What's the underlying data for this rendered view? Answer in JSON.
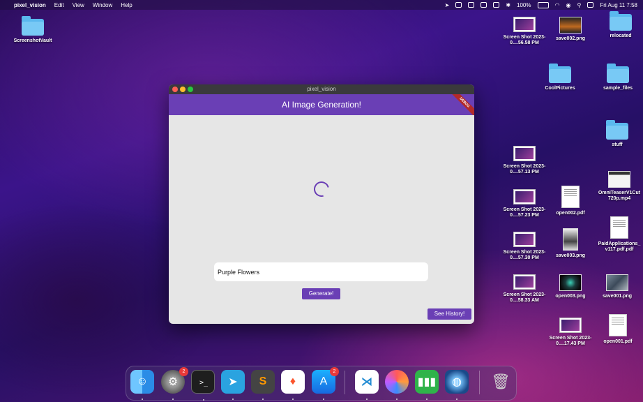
{
  "menubar": {
    "app_name": "pixel_vision",
    "items": [
      "Edit",
      "View",
      "Window",
      "Help"
    ],
    "battery": "100%",
    "clock": "Fri Aug 11  7:58"
  },
  "desktop": {
    "items": [
      {
        "name": "ScreenshotVault",
        "kind": "folder"
      },
      {
        "name": "Screen Shot 2023-0....56.58 PM",
        "kind": "screenshot"
      },
      {
        "name": "save002.png",
        "kind": "image"
      },
      {
        "name": "relocated",
        "kind": "folder"
      },
      {
        "name": "CoolPictures",
        "kind": "folder"
      },
      {
        "name": "sample_files",
        "kind": "folder"
      },
      {
        "name": "stuff",
        "kind": "folder"
      },
      {
        "name": "Screen Shot 2023-0....57.13 PM",
        "kind": "screenshot"
      },
      {
        "name": "OmniTeaserV1Cut 720p.mp4",
        "kind": "video"
      },
      {
        "name": "Screen Shot 2023-0....57.23 PM",
        "kind": "screenshot"
      },
      {
        "name": "open002.pdf",
        "kind": "pdf"
      },
      {
        "name": "PaidApplications_ v117.pdf.pdf",
        "kind": "pdf"
      },
      {
        "name": "Screen Shot 2023-0....57.30 PM",
        "kind": "screenshot"
      },
      {
        "name": "save003.png",
        "kind": "image"
      },
      {
        "name": "Screen Shot 2023-0....58.33 AM",
        "kind": "screenshot"
      },
      {
        "name": "open003.png",
        "kind": "image"
      },
      {
        "name": "save001.png",
        "kind": "image"
      },
      {
        "name": "Screen Shot 2023-0....17.43 PM",
        "kind": "screenshot"
      },
      {
        "name": "open001.pdf",
        "kind": "pdf"
      }
    ]
  },
  "window": {
    "title": "pixel_vision",
    "appbar_title": "AI Image Generation!",
    "debug_banner": "DEBUG",
    "prompt_value": "Purple Flowers",
    "generate_label": "Generate!",
    "history_label": "See History!",
    "loading": true
  },
  "dock": {
    "apps": [
      {
        "name": "Finder",
        "icon": "finder-icon",
        "badge": ""
      },
      {
        "name": "System Settings",
        "icon": "gear-icon",
        "badge": "2"
      },
      {
        "name": "Terminal",
        "icon": "terminal-icon",
        "badge": ""
      },
      {
        "name": "Telegram",
        "icon": "telegram-icon",
        "badge": ""
      },
      {
        "name": "Sublime Text",
        "icon": "sublime-icon",
        "badge": ""
      },
      {
        "name": "Brave",
        "icon": "brave-icon",
        "badge": ""
      },
      {
        "name": "App Store",
        "icon": "appstore-icon",
        "badge": "2"
      },
      {
        "name": "VS Code",
        "icon": "vscode-icon",
        "badge": ""
      },
      {
        "name": "Arc",
        "icon": "arc-icon",
        "badge": ""
      },
      {
        "name": "Numbers",
        "icon": "numbers-icon",
        "badge": ""
      },
      {
        "name": "Globe App",
        "icon": "globe-icon",
        "badge": ""
      },
      {
        "name": "Trash",
        "icon": "trash-icon",
        "badge": ""
      }
    ]
  },
  "colors": {
    "accent": "#6a3fb5",
    "folder": "#5ab8ee",
    "badge": "#e8393a"
  }
}
